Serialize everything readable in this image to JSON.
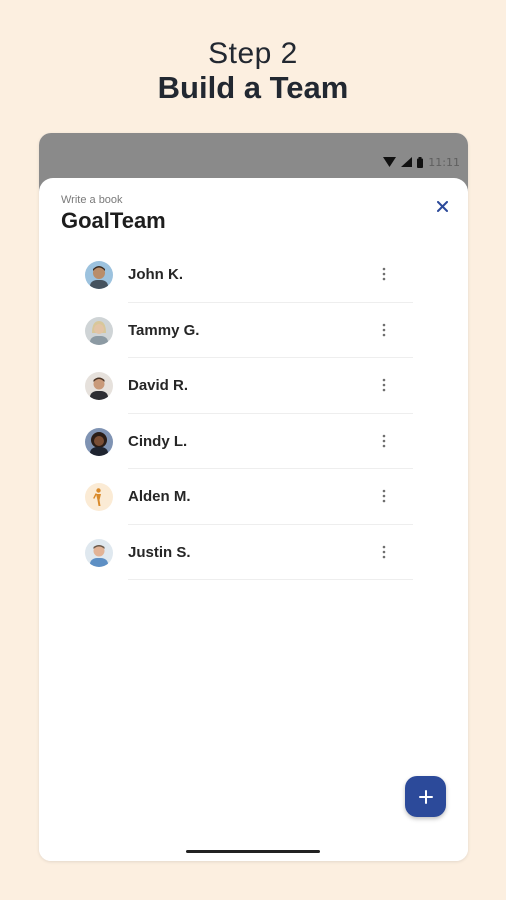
{
  "header": {
    "step": "Step 2",
    "title": "Build a Team"
  },
  "status_bar": {
    "time": "11:11",
    "icons": [
      "wifi-icon",
      "signal-icon",
      "battery-icon"
    ]
  },
  "sheet": {
    "subtitle": "Write a book",
    "title": "GoalTeam",
    "close_icon": "close-icon"
  },
  "members": [
    {
      "name": "John K.",
      "avatar": "avatar-photo"
    },
    {
      "name": "Tammy G.",
      "avatar": "avatar-photo"
    },
    {
      "name": "David R.",
      "avatar": "avatar-photo"
    },
    {
      "name": "Cindy L.",
      "avatar": "avatar-photo"
    },
    {
      "name": "Alden M.",
      "avatar": "avatar-default-figure"
    },
    {
      "name": "Justin S.",
      "avatar": "avatar-photo"
    }
  ],
  "fab": {
    "icon": "plus-icon"
  },
  "colors": {
    "background": "#fcefe0",
    "accent": "#2c4a9a",
    "status_bar": "#8a8a8a"
  }
}
